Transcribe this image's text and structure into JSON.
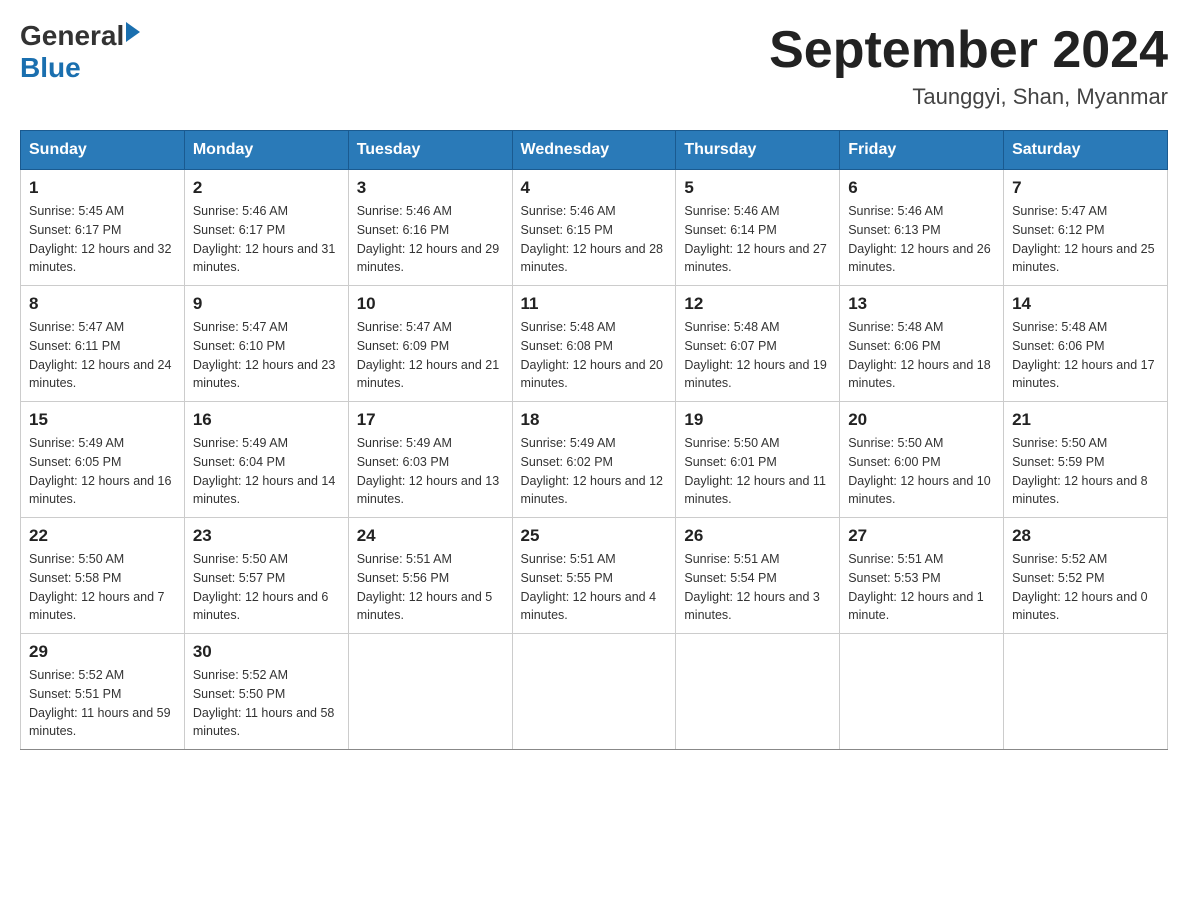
{
  "header": {
    "logo_general": "General",
    "logo_blue": "Blue",
    "title": "September 2024",
    "subtitle": "Taunggyi, Shan, Myanmar"
  },
  "columns": [
    "Sunday",
    "Monday",
    "Tuesday",
    "Wednesday",
    "Thursday",
    "Friday",
    "Saturday"
  ],
  "weeks": [
    [
      {
        "day": "1",
        "sunrise": "Sunrise: 5:45 AM",
        "sunset": "Sunset: 6:17 PM",
        "daylight": "Daylight: 12 hours and 32 minutes."
      },
      {
        "day": "2",
        "sunrise": "Sunrise: 5:46 AM",
        "sunset": "Sunset: 6:17 PM",
        "daylight": "Daylight: 12 hours and 31 minutes."
      },
      {
        "day": "3",
        "sunrise": "Sunrise: 5:46 AM",
        "sunset": "Sunset: 6:16 PM",
        "daylight": "Daylight: 12 hours and 29 minutes."
      },
      {
        "day": "4",
        "sunrise": "Sunrise: 5:46 AM",
        "sunset": "Sunset: 6:15 PM",
        "daylight": "Daylight: 12 hours and 28 minutes."
      },
      {
        "day": "5",
        "sunrise": "Sunrise: 5:46 AM",
        "sunset": "Sunset: 6:14 PM",
        "daylight": "Daylight: 12 hours and 27 minutes."
      },
      {
        "day": "6",
        "sunrise": "Sunrise: 5:46 AM",
        "sunset": "Sunset: 6:13 PM",
        "daylight": "Daylight: 12 hours and 26 minutes."
      },
      {
        "day": "7",
        "sunrise": "Sunrise: 5:47 AM",
        "sunset": "Sunset: 6:12 PM",
        "daylight": "Daylight: 12 hours and 25 minutes."
      }
    ],
    [
      {
        "day": "8",
        "sunrise": "Sunrise: 5:47 AM",
        "sunset": "Sunset: 6:11 PM",
        "daylight": "Daylight: 12 hours and 24 minutes."
      },
      {
        "day": "9",
        "sunrise": "Sunrise: 5:47 AM",
        "sunset": "Sunset: 6:10 PM",
        "daylight": "Daylight: 12 hours and 23 minutes."
      },
      {
        "day": "10",
        "sunrise": "Sunrise: 5:47 AM",
        "sunset": "Sunset: 6:09 PM",
        "daylight": "Daylight: 12 hours and 21 minutes."
      },
      {
        "day": "11",
        "sunrise": "Sunrise: 5:48 AM",
        "sunset": "Sunset: 6:08 PM",
        "daylight": "Daylight: 12 hours and 20 minutes."
      },
      {
        "day": "12",
        "sunrise": "Sunrise: 5:48 AM",
        "sunset": "Sunset: 6:07 PM",
        "daylight": "Daylight: 12 hours and 19 minutes."
      },
      {
        "day": "13",
        "sunrise": "Sunrise: 5:48 AM",
        "sunset": "Sunset: 6:06 PM",
        "daylight": "Daylight: 12 hours and 18 minutes."
      },
      {
        "day": "14",
        "sunrise": "Sunrise: 5:48 AM",
        "sunset": "Sunset: 6:06 PM",
        "daylight": "Daylight: 12 hours and 17 minutes."
      }
    ],
    [
      {
        "day": "15",
        "sunrise": "Sunrise: 5:49 AM",
        "sunset": "Sunset: 6:05 PM",
        "daylight": "Daylight: 12 hours and 16 minutes."
      },
      {
        "day": "16",
        "sunrise": "Sunrise: 5:49 AM",
        "sunset": "Sunset: 6:04 PM",
        "daylight": "Daylight: 12 hours and 14 minutes."
      },
      {
        "day": "17",
        "sunrise": "Sunrise: 5:49 AM",
        "sunset": "Sunset: 6:03 PM",
        "daylight": "Daylight: 12 hours and 13 minutes."
      },
      {
        "day": "18",
        "sunrise": "Sunrise: 5:49 AM",
        "sunset": "Sunset: 6:02 PM",
        "daylight": "Daylight: 12 hours and 12 minutes."
      },
      {
        "day": "19",
        "sunrise": "Sunrise: 5:50 AM",
        "sunset": "Sunset: 6:01 PM",
        "daylight": "Daylight: 12 hours and 11 minutes."
      },
      {
        "day": "20",
        "sunrise": "Sunrise: 5:50 AM",
        "sunset": "Sunset: 6:00 PM",
        "daylight": "Daylight: 12 hours and 10 minutes."
      },
      {
        "day": "21",
        "sunrise": "Sunrise: 5:50 AM",
        "sunset": "Sunset: 5:59 PM",
        "daylight": "Daylight: 12 hours and 8 minutes."
      }
    ],
    [
      {
        "day": "22",
        "sunrise": "Sunrise: 5:50 AM",
        "sunset": "Sunset: 5:58 PM",
        "daylight": "Daylight: 12 hours and 7 minutes."
      },
      {
        "day": "23",
        "sunrise": "Sunrise: 5:50 AM",
        "sunset": "Sunset: 5:57 PM",
        "daylight": "Daylight: 12 hours and 6 minutes."
      },
      {
        "day": "24",
        "sunrise": "Sunrise: 5:51 AM",
        "sunset": "Sunset: 5:56 PM",
        "daylight": "Daylight: 12 hours and 5 minutes."
      },
      {
        "day": "25",
        "sunrise": "Sunrise: 5:51 AM",
        "sunset": "Sunset: 5:55 PM",
        "daylight": "Daylight: 12 hours and 4 minutes."
      },
      {
        "day": "26",
        "sunrise": "Sunrise: 5:51 AM",
        "sunset": "Sunset: 5:54 PM",
        "daylight": "Daylight: 12 hours and 3 minutes."
      },
      {
        "day": "27",
        "sunrise": "Sunrise: 5:51 AM",
        "sunset": "Sunset: 5:53 PM",
        "daylight": "Daylight: 12 hours and 1 minute."
      },
      {
        "day": "28",
        "sunrise": "Sunrise: 5:52 AM",
        "sunset": "Sunset: 5:52 PM",
        "daylight": "Daylight: 12 hours and 0 minutes."
      }
    ],
    [
      {
        "day": "29",
        "sunrise": "Sunrise: 5:52 AM",
        "sunset": "Sunset: 5:51 PM",
        "daylight": "Daylight: 11 hours and 59 minutes."
      },
      {
        "day": "30",
        "sunrise": "Sunrise: 5:52 AM",
        "sunset": "Sunset: 5:50 PM",
        "daylight": "Daylight: 11 hours and 58 minutes."
      },
      null,
      null,
      null,
      null,
      null
    ]
  ]
}
